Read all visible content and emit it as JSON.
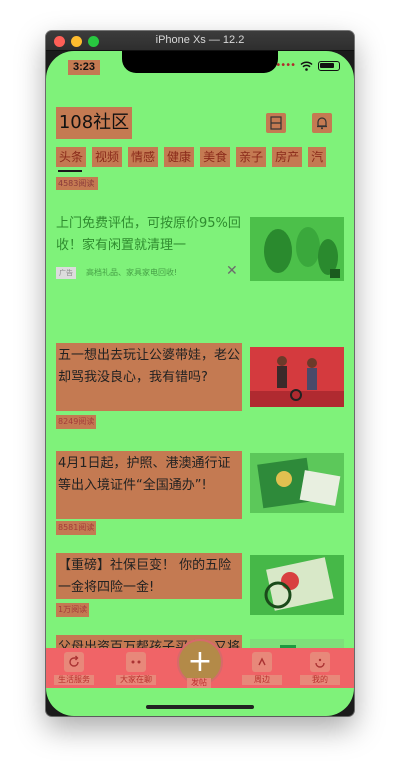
{
  "window": {
    "title": "iPhone Xs — 12.2"
  },
  "status_bar": {
    "time": "3:23"
  },
  "header": {
    "brand": "108社区",
    "scan_icon": "scan-icon",
    "bell_icon": "bell-icon"
  },
  "categories": [
    "头条",
    "视频",
    "情感",
    "健康",
    "美食",
    "亲子",
    "房产",
    "汽"
  ],
  "feed": {
    "prev_item_meta": "4583阅读",
    "ad": {
      "title": "上门免费评估，可按原价95%回收！家有闲置就清理一",
      "badge": "广告",
      "source": "高档礼品、家具家电回收!",
      "close": "✕"
    },
    "articles": [
      {
        "title": "五一想出去玩让公婆带娃，老公却骂我没良心，我有错吗?",
        "meta": "8249阅读"
      },
      {
        "title": "4月1日起，护照、港澳通行证等出入境证件“全国通办”!",
        "meta": "8581阅读"
      },
      {
        "title": "【重磅】社保巨变！ 你的五险一金将四险一金!",
        "meta": "1万阅读"
      },
      {
        "title": "父母出资百万帮孩子买房，又将儿子告上法庭！ 咋回事?",
        "meta": ""
      }
    ]
  },
  "tabbar": {
    "items": [
      {
        "label": "生活服务",
        "icon": "refresh-icon"
      },
      {
        "label": "大家在聊",
        "icon": "chat-icon"
      },
      {
        "label": "周边",
        "icon": "compass-icon"
      },
      {
        "label": "我的",
        "icon": "profile-icon"
      }
    ],
    "publish_label": "发帖",
    "publish_icon": "plus-icon"
  }
}
